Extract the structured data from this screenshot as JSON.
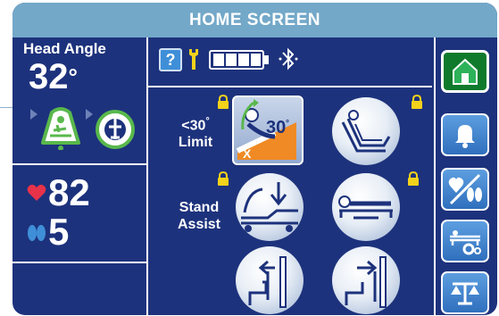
{
  "header": {
    "title": "HOME SCREEN"
  },
  "left": {
    "head_angle_label": "Head Angle",
    "head_angle_value": "32",
    "head_angle_unit": "°",
    "heart_rate": "82",
    "resp_rate": "5"
  },
  "toolbar": {
    "help_label": "?",
    "battery_level": 1.0
  },
  "tiles": {
    "limit_label_line1": "<30",
    "limit_label_deg": "°",
    "limit_label_line2": "Limit",
    "limit_icon_text": "30",
    "limit_icon_deg": "°",
    "stand_label_line1": "Stand",
    "stand_label_line2": "Assist"
  },
  "icons": {
    "help": "question-icon",
    "wrench": "wrench-icon",
    "battery": "battery-icon",
    "bluetooth": "bluetooth-off-icon",
    "home": "home-icon",
    "alarm": "bell-icon",
    "vitals": "heart-lungs-icon",
    "bed_settings": "bed-gear-icon",
    "scale": "scale-icon"
  },
  "colors": {
    "background": "#1d327c",
    "header": "#73a8c8",
    "heart": "#e8324a",
    "lungs": "#3f8fd8",
    "lock": "#f3d21b",
    "home_active": "#0f7a2c",
    "nav_button": "#3b82cf",
    "patient_icon_green": "#59b84c"
  }
}
